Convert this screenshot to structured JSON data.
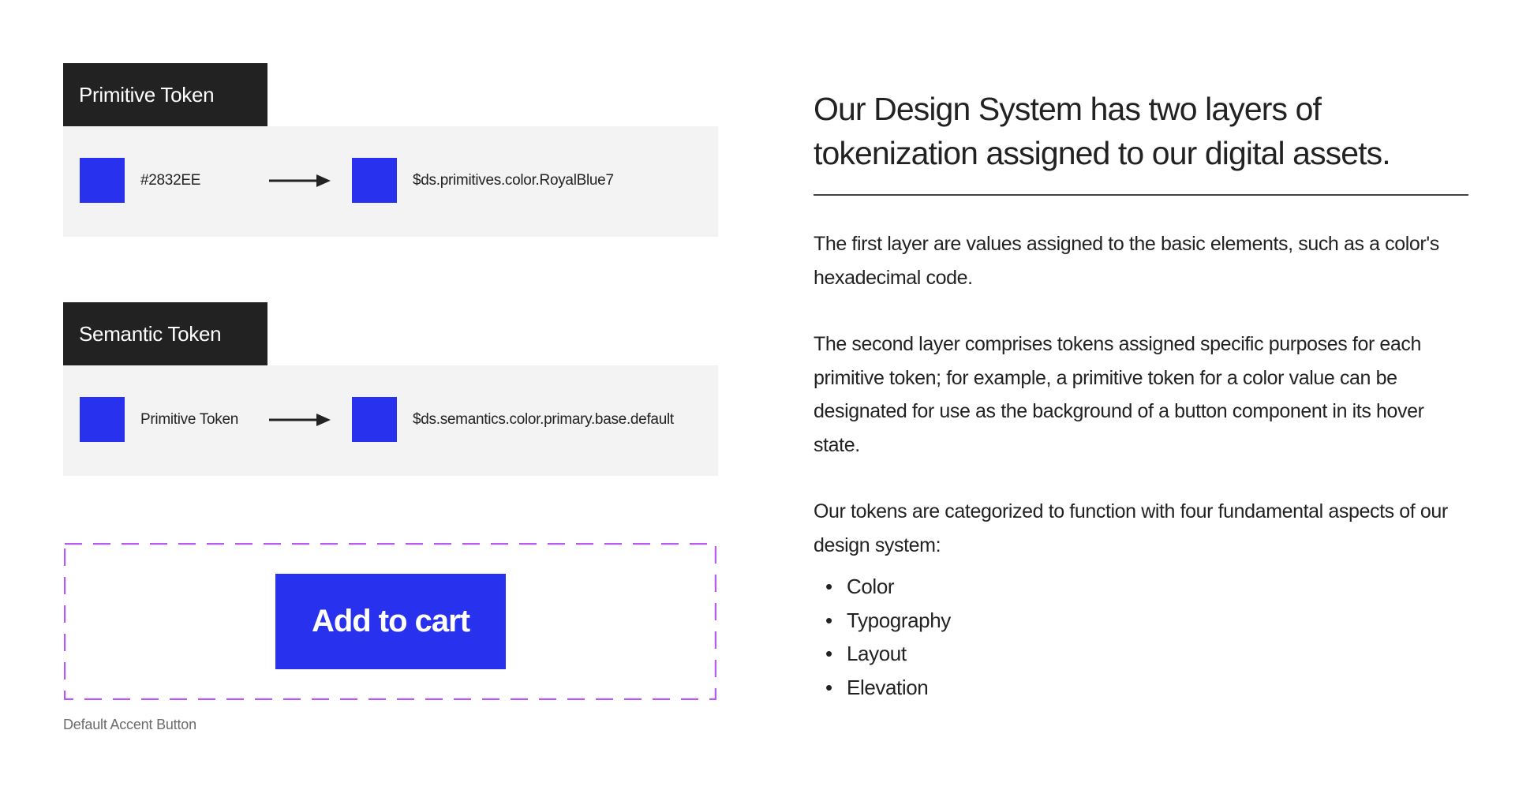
{
  "colors": {
    "accent": "#2832EE",
    "tag_bg": "#222222",
    "panel_bg": "#F3F3F3",
    "dash_border": "#B45CF0",
    "text": "#222222",
    "caption": "#6B6B6B"
  },
  "primitive": {
    "label": "Primitive Token",
    "source_text": "#2832EE",
    "target_text": "$ds.primitives.color.RoyalBlue7",
    "arrow_icon": "arrow-right-icon"
  },
  "semantic": {
    "label": "Semantic Token",
    "source_text": "Primitive Token",
    "target_text": "$ds.semantics.color.primary.base.default",
    "arrow_icon": "arrow-right-icon"
  },
  "example": {
    "button_label": "Add to cart",
    "caption": "Default Accent Button"
  },
  "content": {
    "heading": "Our Design System has two layers of tokenization assigned to our digital assets.",
    "paragraphs": [
      "The first layer are values assigned to the basic elements, such as a color's hexadecimal code.",
      "The second layer comprises tokens assigned specific purposes for each primitive token; for example, a primitive token for a color value can be designated for use as the background of a button component in its hover state.",
      "Our tokens are categorized to function with four fundamental aspects of our design system:"
    ],
    "aspects": [
      "Color",
      "Typography",
      "Layout",
      "Elevation"
    ],
    "bullet": "•"
  }
}
